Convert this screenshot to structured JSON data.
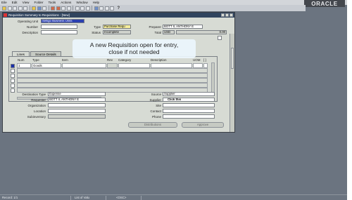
{
  "menubar": {
    "items": [
      "Eile",
      "Edit",
      "View",
      "Folder",
      "Tools",
      "Actions",
      "Window",
      "Help"
    ],
    "brand": "ORACLE"
  },
  "window": {
    "title": "Requisition Summary to Requisitions - [New]"
  },
  "header": {
    "operating_unit_label": "Operating Unit",
    "operating_unit_value": "Selligo Business Units",
    "number_label": "Number",
    "number_value": "",
    "description_label": "Description",
    "description_value": "",
    "type_label": "Type",
    "type_value": "Purchase Requ",
    "status_label": "Status",
    "status_value": "Incomplete",
    "preparer_label": "Preparer",
    "preparer_value": "BOTT II, ANTHONY E",
    "total_label": "Total",
    "currency_value": "USD",
    "total_value": "0.00"
  },
  "tabs": [
    {
      "label": "Lines",
      "active": true
    },
    {
      "label": "Source Details",
      "active": false
    }
  ],
  "lines_table": {
    "columns": [
      "Num",
      "Type",
      "Item",
      "Rev",
      "Category",
      "Description",
      "UOM",
      "[ ]"
    ],
    "rows": [
      {
        "num": "1",
        "type": "Goods",
        "item": "",
        "rev": "",
        "category": "",
        "description": "",
        "uom": ""
      }
    ]
  },
  "details": {
    "destination_type_label": "Destination Type",
    "destination_type_value": "Expense",
    "requester_label": "Requester",
    "requester_value": "BOTT II, ANTHONY E",
    "organization_label": "Organization",
    "organization_value": "",
    "location_label": "Location",
    "location_value": "",
    "subinventory_label": "Subinventory",
    "subinventory_value": "",
    "source_label": "Source",
    "source_value": "Supplier",
    "supplier_label": "Supplier",
    "supplier_value": "Click this",
    "site_label": "Site",
    "site_value": "",
    "contact_label": "Contact",
    "contact_value": "",
    "phone_label": "Phone",
    "phone_value": ""
  },
  "buttons": {
    "distributions": "Distributions",
    "approve": "Approve"
  },
  "callout": {
    "line1": "A new Requisition open for entry,",
    "line2": "close if not needed"
  },
  "statusbar": {
    "record": "Record: 1/1",
    "list": "List of Valu",
    "osc": "<OSC>"
  }
}
